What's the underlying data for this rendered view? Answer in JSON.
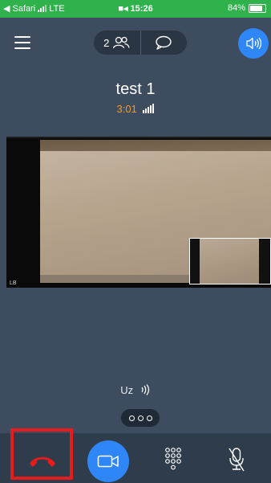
{
  "status_bar": {
    "back_label": "◀ Safari",
    "network": "LTE",
    "time": "15:26",
    "battery": "84%",
    "battery_level": 0.84,
    "color": "#2fb24c"
  },
  "toolbar": {
    "participant_count": "2",
    "menu_icon": "hamburger-menu-icon",
    "participants_icon": "participants-icon",
    "chat_icon": "chat-bubble-icon",
    "speaker_icon": "speaker-icon"
  },
  "call": {
    "name": "test 1",
    "timer": "3:01",
    "timer_color": "#f39a24"
  },
  "video": {
    "corner_label": "LB"
  },
  "speaking": {
    "label": "Uz"
  },
  "controls": {
    "hangup_icon": "phone-hangup-icon",
    "hangup_color": "#e81b1b",
    "video_icon": "video-camera-icon",
    "keypad_icon": "keypad-icon",
    "mic_icon": "microphone-muted-icon",
    "accent": "#2f86f6"
  }
}
